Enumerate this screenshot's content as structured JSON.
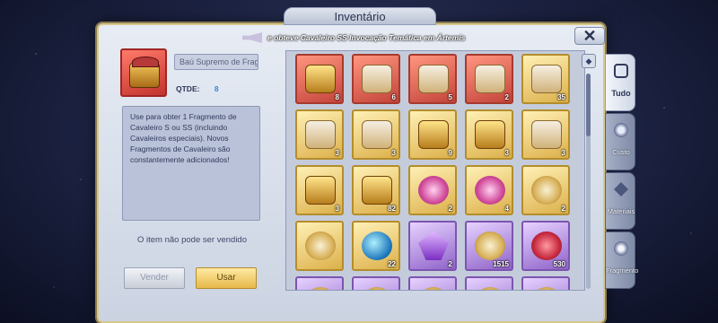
{
  "window": {
    "title": "Inventário"
  },
  "ticker": {
    "text": "e obteve Cavaleiro SS Invocação Temática em Ártemis"
  },
  "close": {
    "label": "✕"
  },
  "detail": {
    "item_name": "Baú Supremo de Frag...",
    "qty_label": "QTDE:",
    "qty_value": "8",
    "description": "Use para obter 1 Fragmento de Cavaleiro S ou SS (incluindo Cavaleiros especiais). Novos Fragmentos de Cavaleiro são constantemente adicionados!",
    "not_sellable": "O item não pode ser vendido",
    "sell_label": "Vender",
    "use_label": "Usar"
  },
  "grid": {
    "items": [
      {
        "style": "red",
        "art": "chest-a",
        "count": "8"
      },
      {
        "style": "red",
        "art": "chest-b",
        "count": "6"
      },
      {
        "style": "red",
        "art": "chest-b",
        "count": "5"
      },
      {
        "style": "red",
        "art": "chest-b",
        "count": "2"
      },
      {
        "style": "gold",
        "art": "chest-b",
        "count": "35"
      },
      {
        "style": "gold",
        "art": "chest-b",
        "count": "3"
      },
      {
        "style": "gold",
        "art": "chest-b",
        "count": "3"
      },
      {
        "style": "gold",
        "art": "chest-a",
        "count": "9"
      },
      {
        "style": "gold",
        "art": "chest-a",
        "count": "3"
      },
      {
        "style": "gold",
        "art": "chest-b",
        "count": "3"
      },
      {
        "style": "gold",
        "art": "chest-a",
        "count": "3"
      },
      {
        "style": "gold",
        "art": "chest-a",
        "count": "82"
      },
      {
        "style": "gold",
        "art": "flower",
        "count": "2"
      },
      {
        "style": "gold",
        "art": "flower",
        "count": "4"
      },
      {
        "style": "gold",
        "art": "disc",
        "count": "2"
      },
      {
        "style": "gold",
        "art": "disc",
        "count": ""
      },
      {
        "style": "gold",
        "art": "orb-blue",
        "count": "22"
      },
      {
        "style": "purple",
        "art": "crystal",
        "count": "2"
      },
      {
        "style": "purple",
        "art": "disc",
        "count": "1515"
      },
      {
        "style": "purple",
        "art": "rose",
        "count": "530"
      },
      {
        "style": "purple",
        "art": "disc",
        "count": ""
      },
      {
        "style": "purple",
        "art": "disc",
        "count": ""
      },
      {
        "style": "purple",
        "art": "disc",
        "count": ""
      },
      {
        "style": "purple",
        "art": "disc",
        "count": ""
      },
      {
        "style": "purple",
        "art": "disc",
        "count": ""
      }
    ]
  },
  "tabs": [
    {
      "label": "Tudo",
      "icon": "all-items-icon"
    },
    {
      "label": "Custo",
      "icon": "cost-icon"
    },
    {
      "label": "Materiais",
      "icon": "materials-icon"
    },
    {
      "label": "Fragmento",
      "icon": "fragment-icon"
    }
  ],
  "colors": {
    "accent_gold": "#e6b94a",
    "qty_blue": "#2d8ae0"
  }
}
